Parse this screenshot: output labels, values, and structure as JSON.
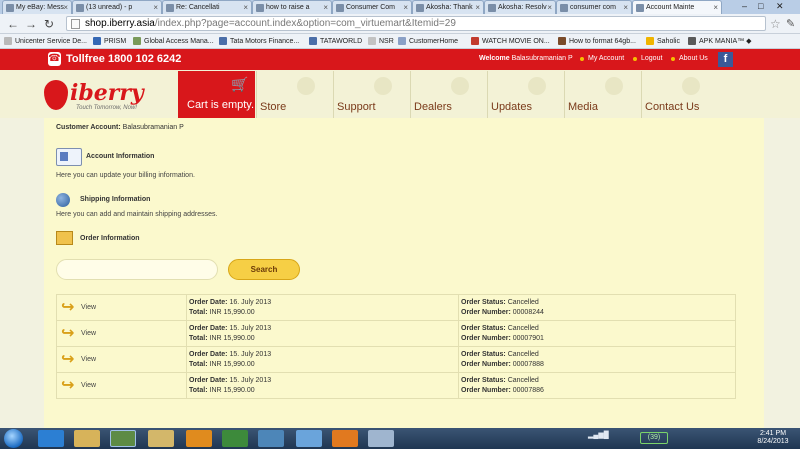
{
  "browser": {
    "tabs": [
      {
        "label": "My eBay: Mess",
        "active": false
      },
      {
        "label": "(13 unread) - p",
        "active": false
      },
      {
        "label": "Re: Cancellati",
        "active": false
      },
      {
        "label": "how to raise a",
        "active": false
      },
      {
        "label": "Consumer Com",
        "active": false
      },
      {
        "label": "Akosha: Thank",
        "active": false
      },
      {
        "label": "Akosha: Resolv",
        "active": false
      },
      {
        "label": "consumer com",
        "active": false
      },
      {
        "label": "Account Mainte",
        "active": true
      }
    ],
    "url_host": "shop.iberry.asia",
    "url_path": "/index.php?page=account.index&option=com_virtuemart&Itemid=29",
    "bookmarks": [
      "Unicenter Service De...",
      "PRISM",
      "Global Access Mana...",
      "Tata Motors Finance...",
      "TATAWORLD",
      "NSR",
      "CustomerHome",
      "WATCH MOVIE ON...",
      "How to format 64gb...",
      "Saholic",
      "APK MANIA™ ◆"
    ],
    "window_controls": [
      "–",
      "□",
      "✕"
    ]
  },
  "header": {
    "tollfree": "Tollfree 1800 102 6242",
    "welcome_prefix": "Welcome",
    "user_name": "Balasubramanian P",
    "links": [
      "My Account",
      "Logout",
      "About Us"
    ],
    "facebook": "f"
  },
  "logo": {
    "wordmark": "iberry",
    "tagline": "Touch Tomorrow, Now!"
  },
  "nav": {
    "cart": "Cart is empty.",
    "items": [
      "Store",
      "Support",
      "Dealers",
      "Updates",
      "Media",
      "Contact Us"
    ]
  },
  "account": {
    "label": "Customer Account:",
    "name": "Balasubramanian P",
    "sections": [
      {
        "title": "Account Information",
        "desc": "Here you can update your billing information."
      },
      {
        "title": "Shipping Information",
        "desc": "Here you can add and maintain shipping addresses."
      },
      {
        "title": "Order Information",
        "desc": ""
      }
    ],
    "search_placeholder": "",
    "search_button": "Search"
  },
  "orders": {
    "view_label": "View",
    "date_label": "Order Date:",
    "total_label": "Total:",
    "status_label": "Order Status:",
    "number_label": "Order Number:",
    "rows": [
      {
        "date": "16. July 2013",
        "total": "INR 15,990.00",
        "status": "Cancelled",
        "number": "00008244"
      },
      {
        "date": "15. July 2013",
        "total": "INR 15,990.00",
        "status": "Cancelled",
        "number": "00007901"
      },
      {
        "date": "15. July 2013",
        "total": "INR 15,990.00",
        "status": "Cancelled",
        "number": "00007888"
      },
      {
        "date": "15. July 2013",
        "total": "INR 15,990.00",
        "status": "Cancelled",
        "number": "00007886"
      }
    ]
  },
  "taskbar": {
    "battery": "(39)",
    "time": "2:41 PM",
    "date": "8/24/2013"
  },
  "colors": {
    "brand_red": "#d8171b",
    "content_bg": "#fbf9cd",
    "search_button": "#f6cf45"
  }
}
